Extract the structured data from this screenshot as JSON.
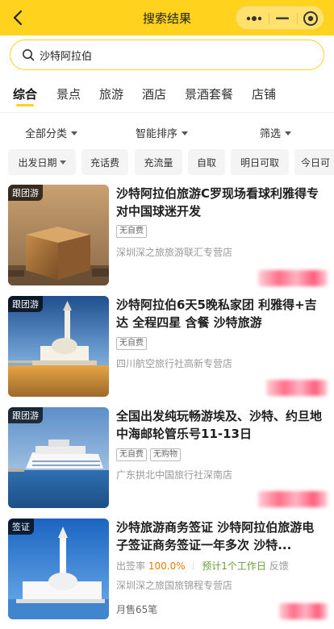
{
  "header": {
    "title": "搜索结果",
    "back_icon": "chevron-left-icon",
    "bg_color": "#ffd21e"
  },
  "search": {
    "value": "沙特阿拉伯"
  },
  "tabs": [
    {
      "label": "综合",
      "active": true
    },
    {
      "label": "景点"
    },
    {
      "label": "旅游"
    },
    {
      "label": "酒店"
    },
    {
      "label": "景酒套餐"
    },
    {
      "label": "店铺"
    }
  ],
  "filters": [
    {
      "label": "全部分类"
    },
    {
      "label": "智能排序"
    },
    {
      "label": "筛选"
    }
  ],
  "chips": [
    {
      "label": "出发日期"
    },
    {
      "label": "充话费"
    },
    {
      "label": "充流量"
    },
    {
      "label": "自取"
    },
    {
      "label": "明日可取"
    },
    {
      "label": "今日可"
    }
  ],
  "results": [
    {
      "badge": "跟团游",
      "title": "沙特阿拉伯旅游C罗现场看球利雅得专对中国球迷开发",
      "tags": [
        "无自费"
      ],
      "shop": "深圳深之旅旅游联汇专营店"
    },
    {
      "badge": "跟团游",
      "title": "沙特阿拉伯6天5晚私家团 利雅得+吉达 全程四星 含餐 沙特旅游",
      "tags": [
        "无自费"
      ],
      "shop": "四川航空旅行社高新专营店"
    },
    {
      "badge": "跟团游",
      "title": "全国出发纯玩畅游埃及、沙特、约旦地中海邮轮管乐号11-13日",
      "tags": [
        "无自费",
        "无购物"
      ],
      "shop": "广东拱北中国旅行社深南店"
    },
    {
      "badge": "签证",
      "title": "沙特旅游商务签证 沙特阿拉伯旅游电子签证商务签证一年多次 沙特...",
      "meta_label": "出签率",
      "meta_rate": "100.0%",
      "meta_time": "预计1个工作日",
      "meta_feedback": "反馈",
      "shop": "深圳深之旅国旅锦程专营店",
      "sold": "月售65笔"
    }
  ]
}
